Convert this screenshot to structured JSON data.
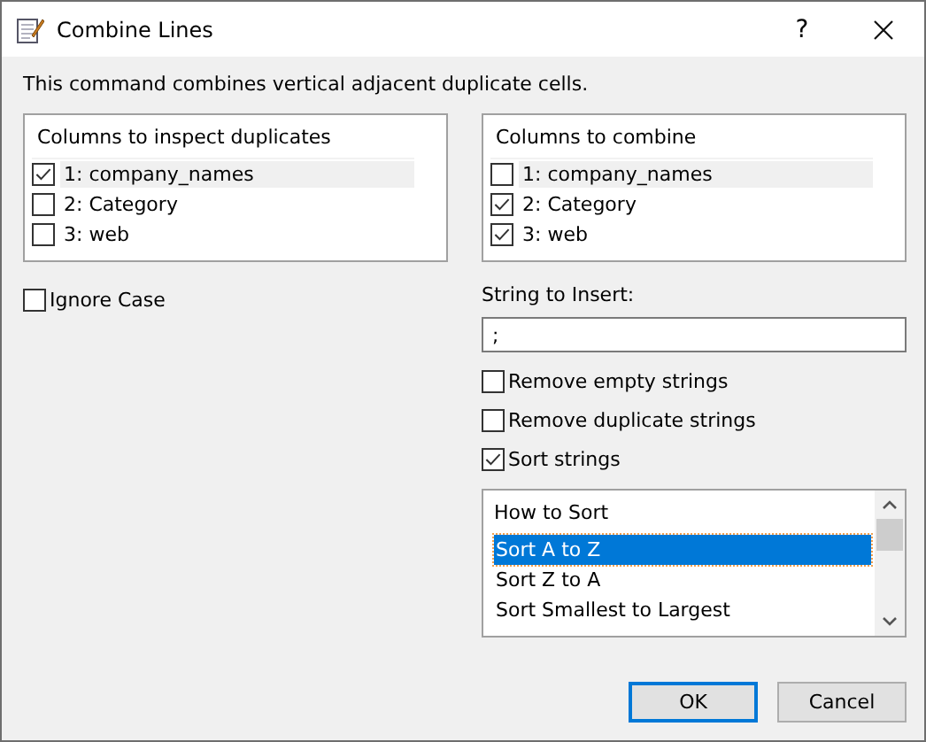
{
  "window": {
    "title": "Combine Lines",
    "help": "?"
  },
  "description": "This command combines vertical adjacent duplicate cells.",
  "inspect_list": {
    "header": "Columns to inspect duplicates",
    "items": [
      {
        "label": "1: company_names",
        "checked": true,
        "selected": true
      },
      {
        "label": "2: Category",
        "checked": false,
        "selected": false
      },
      {
        "label": "3: web",
        "checked": false,
        "selected": false
      }
    ]
  },
  "ignore_case": {
    "label": "Ignore Case",
    "checked": false
  },
  "combine_list": {
    "header": "Columns to combine",
    "items": [
      {
        "label": "1: company_names",
        "checked": false,
        "selected": true
      },
      {
        "label": "2: Category",
        "checked": true,
        "selected": false
      },
      {
        "label": "3: web",
        "checked": true,
        "selected": false
      }
    ]
  },
  "string_to_insert": {
    "label": "String to Insert:",
    "value": ";"
  },
  "options": [
    {
      "label": "Remove empty strings",
      "checked": false
    },
    {
      "label": "Remove duplicate strings",
      "checked": false
    },
    {
      "label": "Sort strings",
      "checked": true
    }
  ],
  "sort_list": {
    "header": "How to Sort",
    "items": [
      {
        "label": "Sort A to Z",
        "selected": true
      },
      {
        "label": "Sort Z to A",
        "selected": false
      },
      {
        "label": "Sort Smallest to Largest",
        "selected": false
      }
    ]
  },
  "buttons": [
    {
      "label": "OK",
      "default": true
    },
    {
      "label": "Cancel",
      "default": false
    }
  ]
}
